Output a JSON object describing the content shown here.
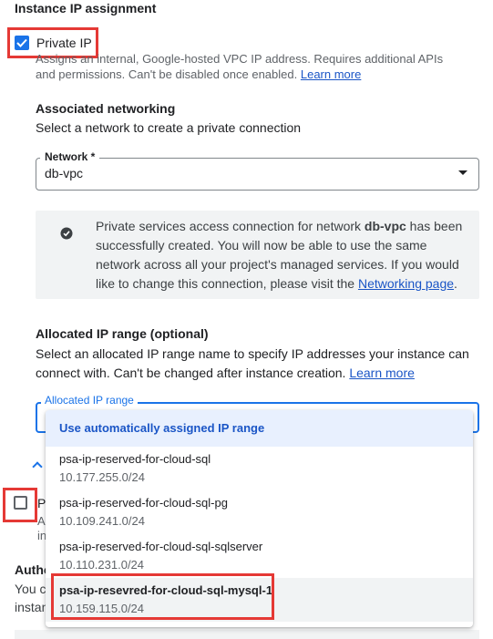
{
  "section_title": "Instance IP assignment",
  "private_ip": {
    "label": "Private IP",
    "checked": true,
    "desc_before": "Assigns an internal, Google-hosted VPC IP address. Requires additional APIs and permissions. Can't be disabled once enabled.",
    "learn_more": "Learn more"
  },
  "associated_networking": {
    "title": "Associated networking",
    "subtitle": "Select a network to create a private connection",
    "network_label": "Network *",
    "network_value": "db-vpc"
  },
  "info": {
    "icon": "check-circle-icon",
    "text_before": "Private services access connection for network ",
    "network_bold": "db-vpc",
    "text_after": " has been successfully created. You will now be able to use the same network across all your project's managed services. If you would like to change this connection, please visit the ",
    "link": "Networking page",
    "end": "."
  },
  "allocated_range": {
    "title": "Allocated IP range (optional)",
    "desc": "Select an allocated IP range name to specify IP addresses your instance can connect with. Can't be changed after instance creation.",
    "learn_more": "Learn more",
    "field_label": "Allocated IP range",
    "auto_option": "Use automatically assigned IP range",
    "options": [
      {
        "name": "psa-ip-reserved-for-cloud-sql",
        "ip": "10.177.255.0/24"
      },
      {
        "name": "psa-ip-reserved-for-cloud-sql-pg",
        "ip": "10.109.241.0/24"
      },
      {
        "name": "psa-ip-reserved-for-cloud-sql-sqlserver",
        "ip": "10.110.231.0/24"
      },
      {
        "name": "psa-ip-resevred-for-cloud-sql-mysql-1",
        "ip": "10.159.115.0/24"
      }
    ]
  },
  "hidden_fragments": {
    "public_ip_fragment": "P",
    "public_desc_fragment": "As",
    "public_desc_fragment2": "ins",
    "auth_title_fragment": "Autho",
    "auth_text_fragment1": "You ca",
    "auth_text_fragment2": "instan"
  },
  "colors": {
    "accent": "#1a73e8",
    "highlight": "#e53935"
  }
}
